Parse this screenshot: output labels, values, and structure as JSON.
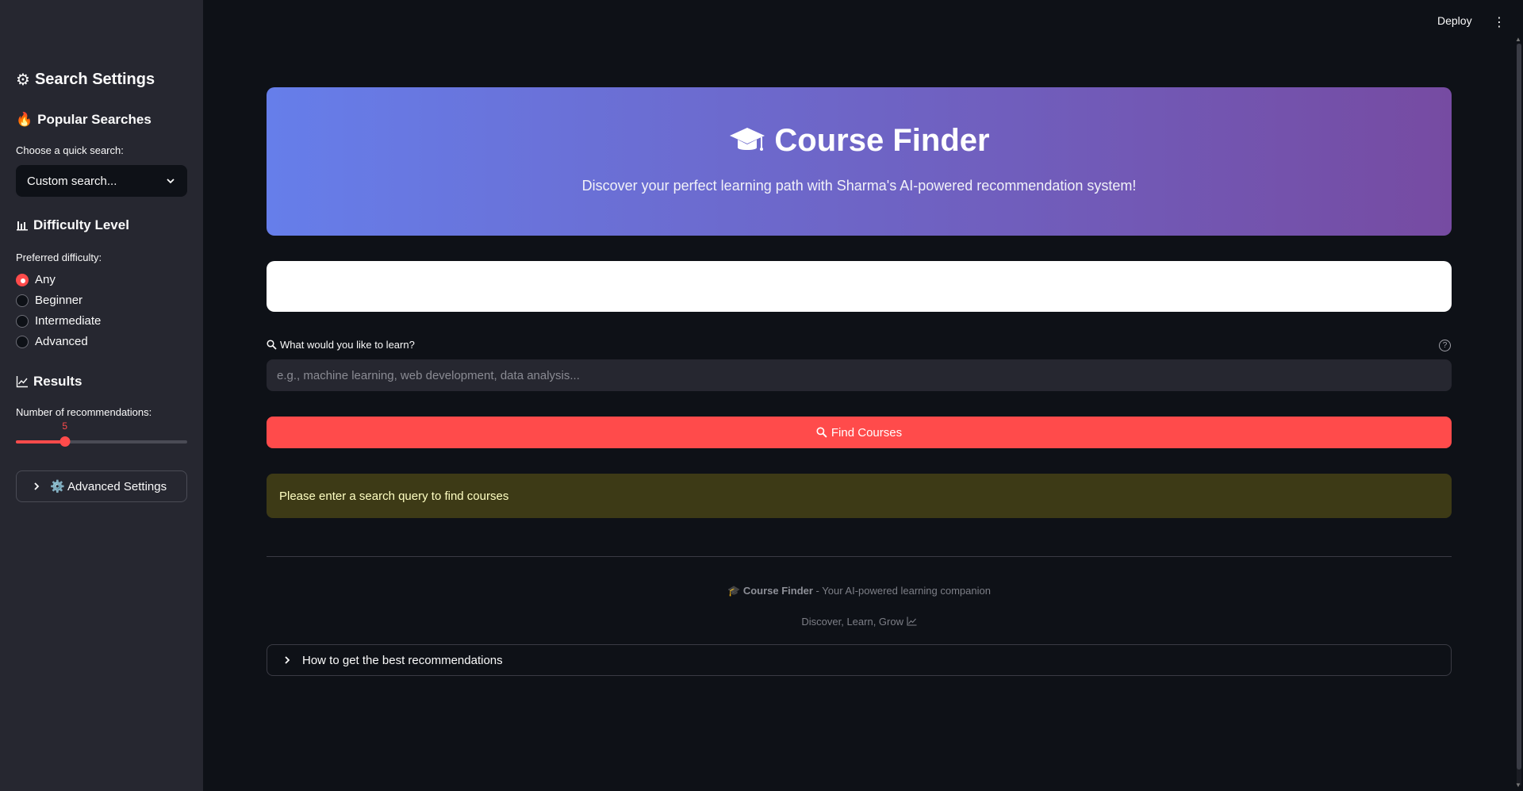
{
  "sidebar": {
    "title": "Search Settings",
    "popular": {
      "heading": "Popular Searches",
      "label": "Choose a quick search:",
      "selected": "Custom search..."
    },
    "difficulty": {
      "heading": "Difficulty Level",
      "label": "Preferred difficulty:",
      "options": [
        "Any",
        "Beginner",
        "Intermediate",
        "Advanced"
      ],
      "selected": "Any"
    },
    "results": {
      "heading": "Results",
      "label": "Number of recommendations:",
      "value": "5",
      "fraction": 0.286
    },
    "advanced": "⚙️ Advanced Settings"
  },
  "topbar": {
    "deploy": "Deploy"
  },
  "hero": {
    "title": "Course Finder",
    "subtitle": "Discover your perfect learning path with Sharma's AI-powered recommendation system!"
  },
  "search": {
    "label": "What would you like to learn?",
    "placeholder": "e.g., machine learning, web development, data analysis...",
    "value": ""
  },
  "find_button": "Find Courses",
  "warning": "Please enter a search query to find courses",
  "footer": {
    "brand": "Course Finder",
    "tagline": " - Your AI-powered learning companion",
    "motto": "Discover, Learn, Grow"
  },
  "tips_expander": "How to get the best recommendations",
  "colors": {
    "accent": "#ff4b4b",
    "hero_start": "#667eea",
    "hero_end": "#764ba2",
    "sidebar_bg": "#262730",
    "page_bg": "#0e1117",
    "warning_bg": "#3d3a16"
  },
  "icons": {
    "settings": "gear-icon",
    "popular": "fire-icon",
    "difficulty": "bar-chart-icon",
    "results": "line-chart-icon",
    "hero": "graduation-cap-icon",
    "search": "magnifier-icon",
    "help": "question-circle-icon",
    "menu": "kebab-menu-icon"
  }
}
